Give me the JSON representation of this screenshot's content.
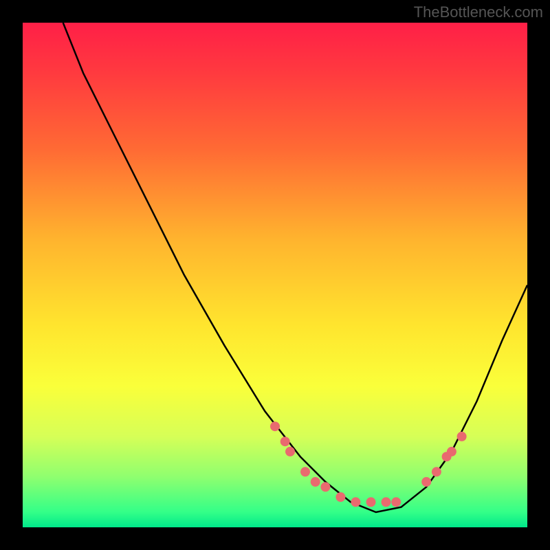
{
  "watermark": "TheBottleneck.com",
  "chart_data": {
    "type": "line",
    "title": "",
    "xlabel": "",
    "ylabel": "",
    "xlim": [
      0,
      100
    ],
    "ylim": [
      0,
      100
    ],
    "curve": {
      "x": [
        8,
        12,
        18,
        25,
        32,
        40,
        48,
        55,
        60,
        65,
        70,
        75,
        80,
        85,
        90,
        95,
        100
      ],
      "y": [
        100,
        90,
        78,
        64,
        50,
        36,
        23,
        14,
        9,
        5,
        3,
        4,
        8,
        15,
        25,
        37,
        48
      ]
    },
    "points": {
      "x": [
        50,
        52,
        53,
        56,
        58,
        60,
        63,
        66,
        69,
        72,
        74,
        80,
        82,
        84,
        85,
        87
      ],
      "y": [
        20,
        17,
        15,
        11,
        9,
        8,
        6,
        5,
        5,
        5,
        5,
        9,
        11,
        14,
        15,
        18
      ]
    },
    "point_color": "#e96a6f",
    "line_color": "#000000"
  }
}
